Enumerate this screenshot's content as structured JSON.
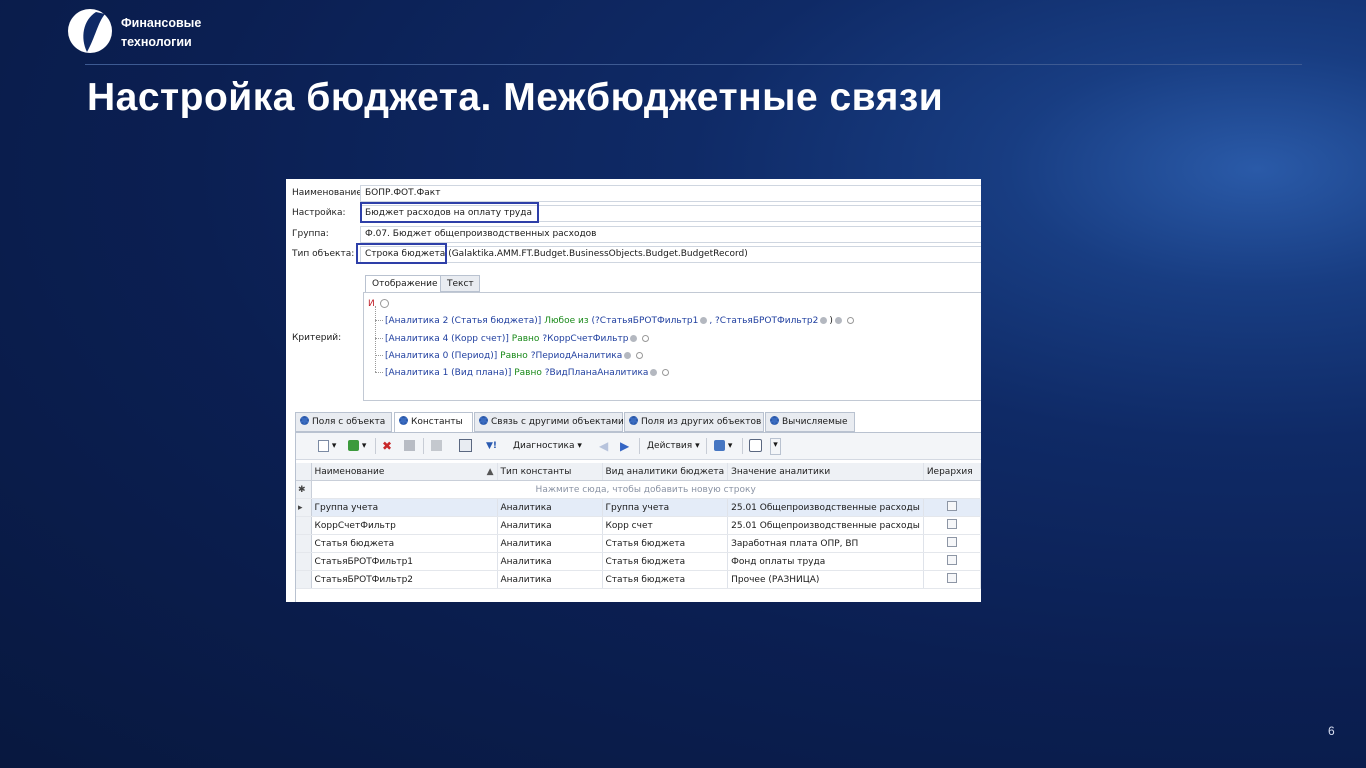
{
  "brand": {
    "line1": "Финансовые",
    "line2": "технологии"
  },
  "slide": {
    "title": "Настройка бюджета. Межбюджетные связи",
    "page": "6"
  },
  "form": {
    "name_label": "Наименование:",
    "name_value": "БОПР.ФОТ.Факт",
    "setting_label": "Настройка:",
    "setting_value": "Бюджет расходов на оплату труда",
    "group_label": "Группа:",
    "group_value": "Ф.07. Бюджет общепроизводственных расходов",
    "type_label": "Тип объекта:",
    "type_value_main": "Строка бюджета",
    "type_value_rest": "(Galaktika.AMM.FT.Budget.BusinessObjects.Budget.BudgetRecord)",
    "criteria_label": "Критерий:"
  },
  "criteria": {
    "tabs": [
      "Отображение",
      "Текст"
    ],
    "root": "И",
    "lines": [
      {
        "field": "[Аналитика 2 (Статья бюджета)]",
        "op": "Любое из",
        "params": "(?СтатьяБРОТФильтр1",
        "params2": ", ?СтатьяБРОТФильтр2",
        "tail": ")"
      },
      {
        "field": "[Аналитика 4 (Корр счет)]",
        "op": "Равно",
        "params": "?КоррСчетФильтр"
      },
      {
        "field": "[Аналитика 0 (Период)]",
        "op": "Равно",
        "params": "?ПериодАналитика"
      },
      {
        "field": "[Аналитика 1 (Вид плана)]",
        "op": "Равно",
        "params": "?ВидПланаАналитика"
      }
    ]
  },
  "tabs": [
    "Поля с объекта",
    "Константы",
    "Связь с другими объектами",
    "Поля из других объектов",
    "Вычисляемые"
  ],
  "toolbar": {
    "diagnostics": "Диагностика",
    "actions": "Действия"
  },
  "grid": {
    "columns": [
      "Наименование",
      "Тип константы",
      "Вид аналитики бюджета",
      "Значение аналитики",
      "Иерархия"
    ],
    "new_row_hint": "Нажмите сюда, чтобы добавить новую строку",
    "rows": [
      [
        "Группа учета",
        "Аналитика",
        "Группа учета",
        "25.01 Общепроизводственные расходы"
      ],
      [
        "КоррСчетФильтр",
        "Аналитика",
        "Корр счет",
        "25.01 Общепроизводственные расходы"
      ],
      [
        "Статья бюджета",
        "Аналитика",
        "Статья бюджета",
        "Заработная плата ОПР, ВП"
      ],
      [
        "СтатьяБРОТФильтр1",
        "Аналитика",
        "Статья бюджета",
        "Фонд оплаты труда"
      ],
      [
        "СтатьяБРОТФильтр2",
        "Аналитика",
        "Статья бюджета",
        "Прочее (РАЗНИЦА)"
      ]
    ]
  }
}
